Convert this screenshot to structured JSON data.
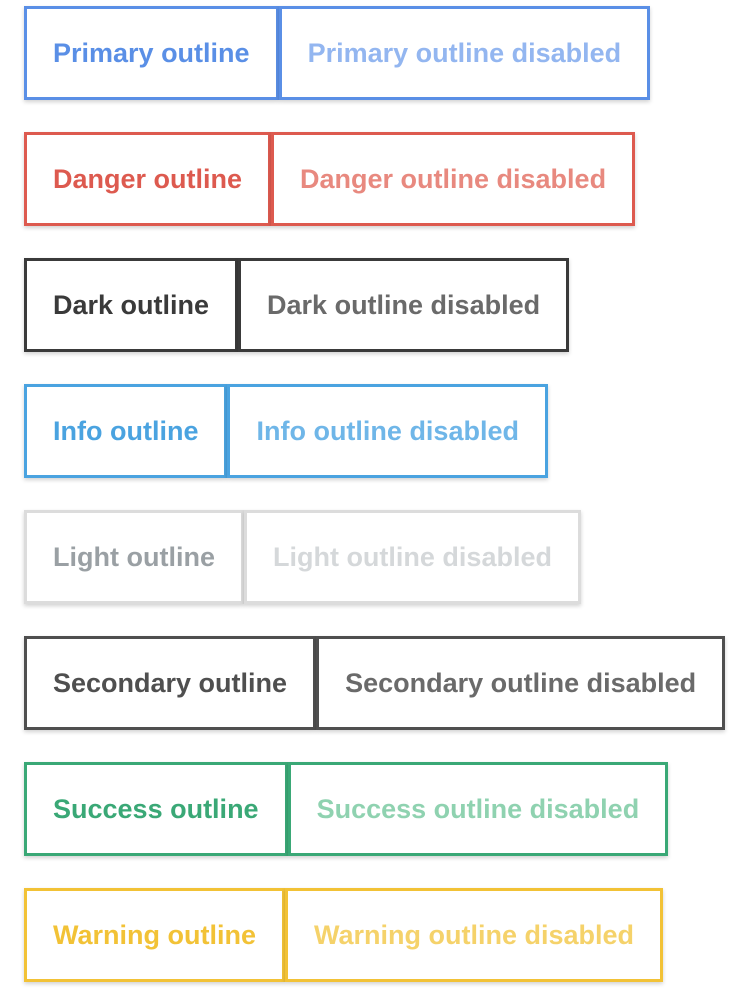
{
  "rows": [
    {
      "variant": "primary",
      "label": "Primary outline",
      "disabled_label": "Primary outline disabled",
      "color": "#5a8fe6"
    },
    {
      "variant": "danger",
      "label": "Danger outline",
      "disabled_label": "Danger outline disabled",
      "color": "#dd5a4f"
    },
    {
      "variant": "dark",
      "label": "Dark outline",
      "disabled_label": "Dark outline disabled",
      "color": "#3a3a3a"
    },
    {
      "variant": "info",
      "label": "Info outline",
      "disabled_label": "Info outline disabled",
      "color": "#4aa3e0"
    },
    {
      "variant": "light",
      "label": "Light outline",
      "disabled_label": "Light outline disabled",
      "color": "#9aa0a4"
    },
    {
      "variant": "secondary",
      "label": "Secondary outline",
      "disabled_label": "Secondary outline disabled",
      "color": "#4f4f4f"
    },
    {
      "variant": "success",
      "label": "Success outline",
      "disabled_label": "Success outline disabled",
      "color": "#3aa876"
    },
    {
      "variant": "warning",
      "label": "Warning outline",
      "disabled_label": "Warning outline disabled",
      "color": "#f2c236"
    }
  ]
}
